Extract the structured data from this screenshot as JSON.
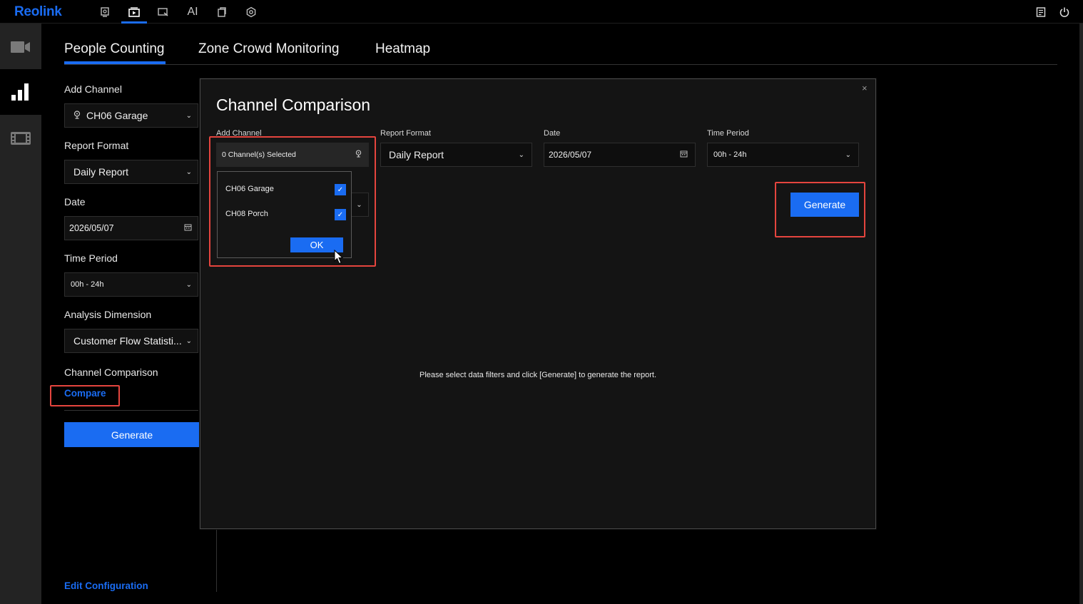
{
  "app": {
    "brand": "Reolink"
  },
  "topbar": {
    "ai_label": "AI",
    "icons": [
      "monitor-icon",
      "playback-icon",
      "remote-icon",
      "ai-icon",
      "file-icon",
      "settings-icon",
      "notes-icon",
      "power-icon"
    ],
    "accent": "#1a6cf2"
  },
  "rail": {
    "items": [
      "camera-icon",
      "stats-icon",
      "filmstrip-icon"
    ]
  },
  "tabs": [
    {
      "label": "People Counting",
      "active": true
    },
    {
      "label": "Zone Crowd Monitoring",
      "active": false
    },
    {
      "label": "Heatmap",
      "active": false
    }
  ],
  "left_form": {
    "add_channel_label": "Add Channel",
    "add_channel_value": "CH06 Garage",
    "report_format_label": "Report Format",
    "report_format_value": "Daily Report",
    "date_label": "Date",
    "date_value": "2026/05/07",
    "time_period_label": "Time Period",
    "time_period_value": "00h - 24h",
    "analysis_dimension_label": "Analysis Dimension",
    "analysis_dimension_value": "Customer Flow Statisti...",
    "channel_comparison_label": "Channel Comparison",
    "compare_link": "Compare",
    "generate_label": "Generate",
    "edit_config_link": "Edit Configuration"
  },
  "modal": {
    "title": "Channel Comparison",
    "close": "×",
    "add_channel_label": "Add Channel",
    "add_channel_value": "0 Channel(s) Selected",
    "report_format_label": "Report Format",
    "report_format_value": "Daily Report",
    "date_label": "Date",
    "date_value": "2026/05/07",
    "time_period_label": "Time Period",
    "time_period_value": "00h - 24h",
    "dropdown_options": [
      {
        "label": "CH06 Garage",
        "checked": true
      },
      {
        "label": "CH08 Porch",
        "checked": true
      }
    ],
    "ok_label": "OK",
    "generate_label": "Generate",
    "placeholder": "Please select data filters and click [Generate] to generate the report."
  },
  "colors": {
    "highlight": "#e5453e",
    "primary": "#1a6cf2"
  }
}
